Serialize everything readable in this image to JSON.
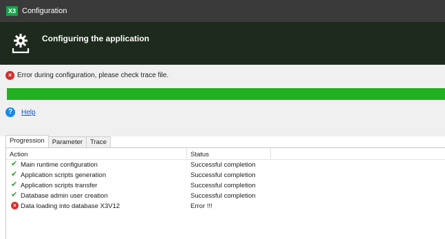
{
  "window": {
    "title": "Configuration",
    "app_icon_text": "X3"
  },
  "header": {
    "title": "Configuring the application",
    "icon": "gear-icon"
  },
  "error": {
    "message": "Error during configuration, please check trace file.",
    "icon": "error-icon"
  },
  "progress": {
    "percent": 100,
    "color": "#20b020"
  },
  "help": {
    "label": "Help",
    "icon": "help-icon"
  },
  "tabs": [
    {
      "label": "Progression",
      "active": true
    },
    {
      "label": "Parameter",
      "active": false
    },
    {
      "label": "Trace",
      "active": false
    }
  ],
  "table": {
    "columns": [
      "Action",
      "Status"
    ],
    "rows": [
      {
        "action": "Main runtime configuration",
        "status": "Successful completion",
        "icon": "check-icon"
      },
      {
        "action": "Application scripts generation",
        "status": "Successful completion",
        "icon": "check-icon"
      },
      {
        "action": "Application scripts transfer",
        "status": "Successful completion",
        "icon": "check-icon"
      },
      {
        "action": "Database admin user creation",
        "status": "Successful completion",
        "icon": "check-icon"
      },
      {
        "action": "Data loading into database X3V12",
        "status": "Error !!!",
        "icon": "error-icon"
      }
    ]
  }
}
